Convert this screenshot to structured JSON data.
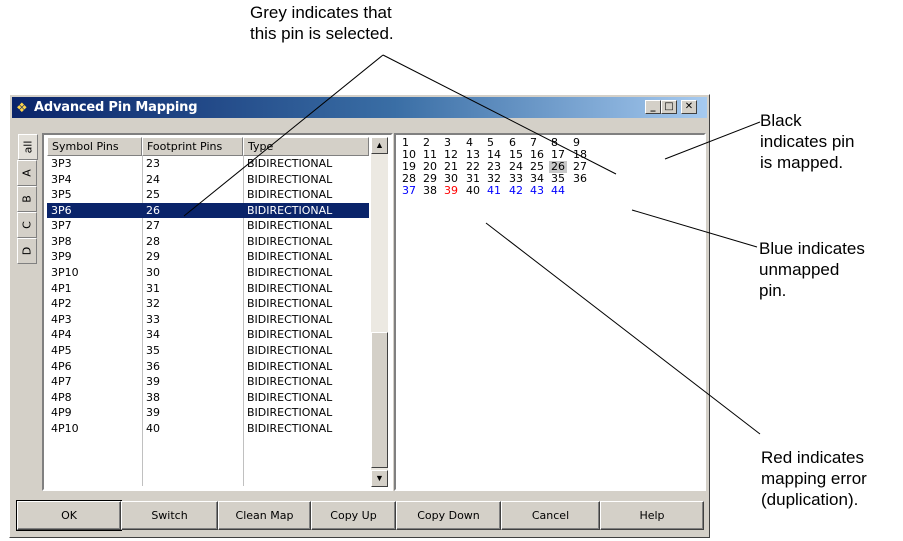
{
  "annotations": {
    "grey_selected": [
      "Grey indicates that",
      "this pin is selected."
    ],
    "black_mapped": [
      "Black",
      "indicates pin",
      "is mapped."
    ],
    "blue_unmapped": [
      "Blue indicates",
      "unmapped",
      "pin."
    ],
    "red_error": [
      "Red indicates",
      "mapping error",
      "(duplication)."
    ]
  },
  "window": {
    "title": "Advanced Pin Mapping",
    "controls": {
      "minimize": "_",
      "maximize": "□",
      "close": "✕"
    }
  },
  "tabs": [
    "all",
    "A",
    "B",
    "C",
    "D"
  ],
  "table": {
    "headers": [
      "Symbol Pins",
      "Footprint Pins",
      "Type"
    ],
    "rows": [
      [
        "3P3",
        "23",
        "BIDIRECTIONAL"
      ],
      [
        "3P4",
        "24",
        "BIDIRECTIONAL"
      ],
      [
        "3P5",
        "25",
        "BIDIRECTIONAL"
      ],
      [
        "3P6",
        "26",
        "BIDIRECTIONAL"
      ],
      [
        "3P7",
        "27",
        "BIDIRECTIONAL"
      ],
      [
        "3P8",
        "28",
        "BIDIRECTIONAL"
      ],
      [
        "3P9",
        "29",
        "BIDIRECTIONAL"
      ],
      [
        "3P10",
        "30",
        "BIDIRECTIONAL"
      ],
      [
        "4P1",
        "31",
        "BIDIRECTIONAL"
      ],
      [
        "4P2",
        "32",
        "BIDIRECTIONAL"
      ],
      [
        "4P3",
        "33",
        "BIDIRECTIONAL"
      ],
      [
        "4P4",
        "34",
        "BIDIRECTIONAL"
      ],
      [
        "4P5",
        "35",
        "BIDIRECTIONAL"
      ],
      [
        "4P6",
        "36",
        "BIDIRECTIONAL"
      ],
      [
        "4P7",
        "39",
        "BIDIRECTIONAL"
      ],
      [
        "4P8",
        "38",
        "BIDIRECTIONAL"
      ],
      [
        "4P9",
        "39",
        "BIDIRECTIONAL"
      ],
      [
        "4P10",
        "40",
        "BIDIRECTIONAL"
      ],
      [
        "",
        "",
        ""
      ],
      [
        "",
        "",
        ""
      ]
    ],
    "selected_row": 3
  },
  "pin_colors": {
    "mapped": "#000000",
    "unmapped": "#0000ff",
    "error": "#ff0000",
    "selected_bg": "#c8c8c8"
  },
  "pins": [
    [
      "1",
      "2",
      "3",
      "4",
      "5",
      "6",
      "7",
      "8",
      "9"
    ],
    [
      "10",
      "11",
      "12",
      "13",
      "14",
      "15",
      "16",
      "17",
      "18"
    ],
    [
      "19",
      "20",
      "21",
      "22",
      "23",
      "24",
      "25",
      "26",
      "27"
    ],
    [
      "28",
      "29",
      "30",
      "31",
      "32",
      "33",
      "34",
      "35",
      "36"
    ],
    [
      "37",
      "38",
      "39",
      "40",
      "41",
      "42",
      "43",
      "44"
    ]
  ],
  "pin_status": [
    [
      "mapped",
      "mapped",
      "mapped",
      "mapped",
      "mapped",
      "mapped",
      "mapped",
      "mapped",
      "mapped"
    ],
    [
      "mapped",
      "mapped",
      "mapped",
      "mapped",
      "mapped",
      "mapped",
      "mapped",
      "mapped",
      "mapped"
    ],
    [
      "mapped",
      "mapped",
      "mapped",
      "mapped",
      "mapped",
      "mapped",
      "mapped",
      "selected",
      "mapped"
    ],
    [
      "mapped",
      "mapped",
      "mapped",
      "mapped",
      "mapped",
      "mapped",
      "mapped",
      "mapped",
      "mapped"
    ],
    [
      "unmapped",
      "mapped",
      "error",
      "mapped",
      "unmapped",
      "unmapped",
      "unmapped",
      "unmapped"
    ]
  ],
  "buttons": [
    "OK",
    "Switch",
    "Clean Map",
    "Copy Up",
    "Copy Down",
    "Cancel",
    "Help"
  ]
}
